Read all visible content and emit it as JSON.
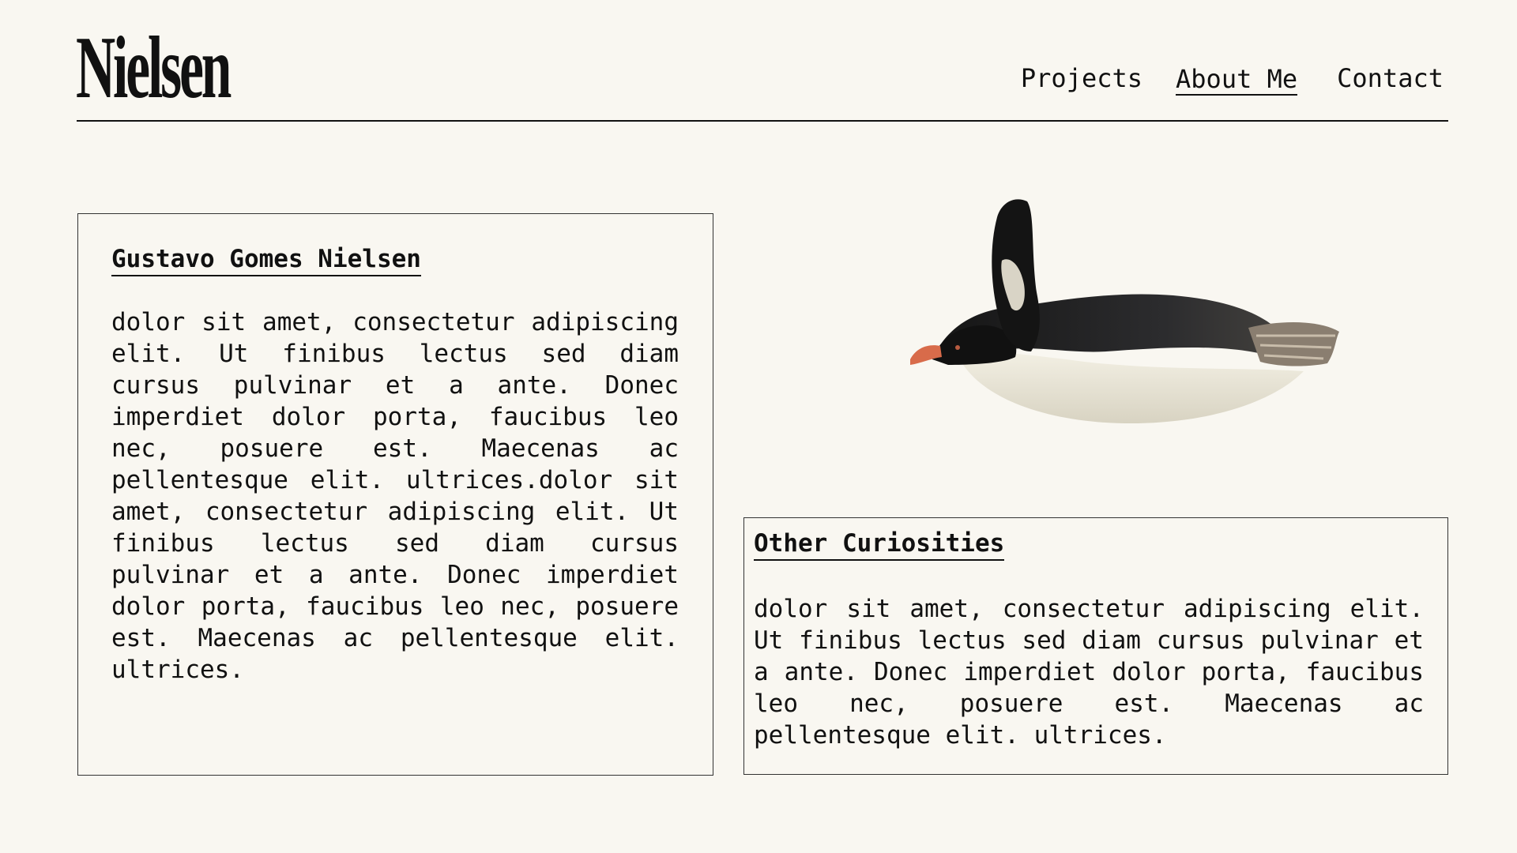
{
  "header": {
    "logo": "Nielsen",
    "nav": [
      {
        "label": "Projects"
      },
      {
        "label": "About Me"
      },
      {
        "label": "Contact"
      }
    ]
  },
  "bio": {
    "title": "Gustavo Gomes Nielsen",
    "text": "dolor sit amet, consectetur adipiscing elit. Ut finibus lectus sed diam cursus pulvinar et a ante. Donec imperdiet dolor porta, faucibus leo nec, posuere est. Maecenas ac pellentesque elit. ultrices.dolor sit amet, consectetur adipiscing elit. Ut finibus lectus sed diam cursus pulvinar et a ante. Donec imperdiet dolor porta, faucibus leo nec, posuere est. Maecenas ac pellentesque elit. ultrices."
  },
  "curiosities": {
    "title": "Other Curiosities",
    "text": "dolor sit amet, consectetur adipiscing elit. Ut finibus lectus sed diam cursus pulvinar et a ante. Donec imperdiet dolor porta, faucibus leo nec, posuere est. Maecenas ac pellentesque elit. ultrices."
  },
  "image": {
    "subject": "penguin-photo"
  },
  "colors": {
    "background": "#f9f7f1",
    "text": "#111111"
  }
}
